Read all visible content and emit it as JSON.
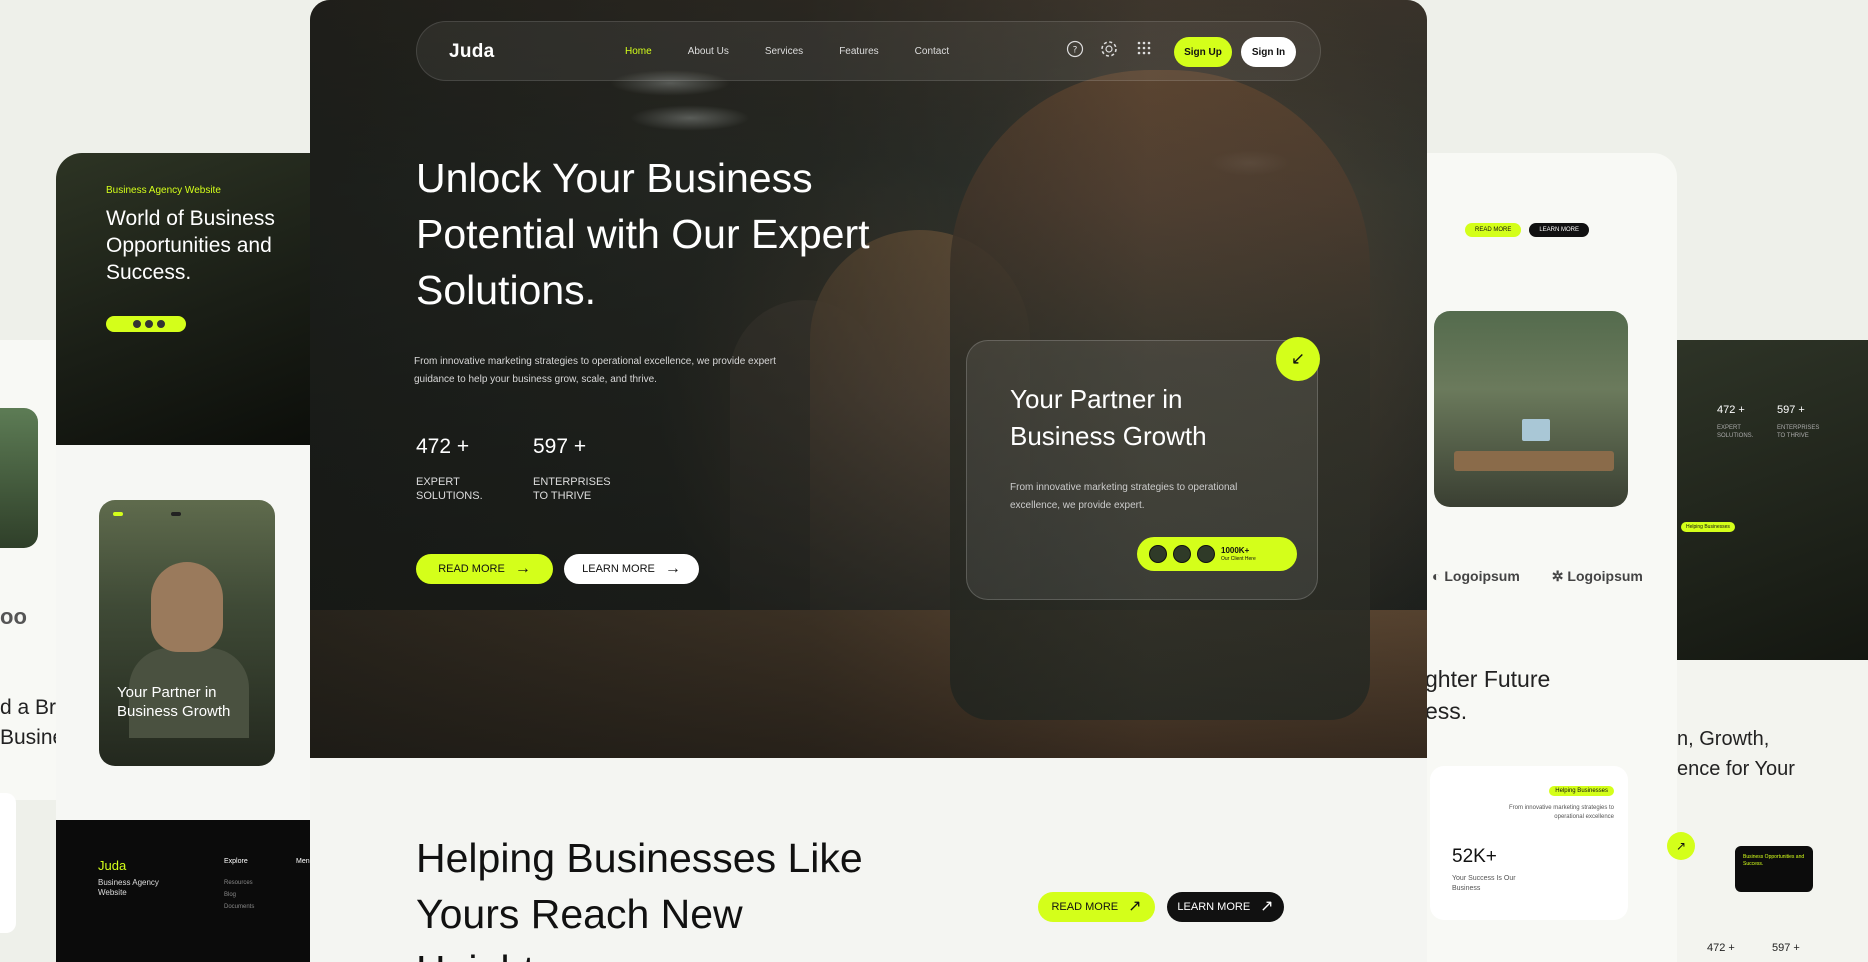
{
  "nav": {
    "logo": "Juda",
    "links": [
      "Home",
      "About Us",
      "Services",
      "Features",
      "Contact"
    ],
    "active_index": 0,
    "icons": [
      "help-circle-icon",
      "gear-icon",
      "grid-icon"
    ],
    "signup": "Sign Up",
    "signin": "Sign In"
  },
  "hero": {
    "title": "Unlock Your Business Potential with Our Expert Solutions.",
    "description": "From innovative marketing strategies to operational excellence, we provide expert guidance to help your business grow, scale, and thrive.",
    "stats": [
      {
        "value": "472 +",
        "label": "EXPERT SOLUTIONS."
      },
      {
        "value": "597 +",
        "label": "ENTERPRISES TO THRIVE"
      }
    ],
    "read_more": "READ MORE",
    "learn_more": "LEARN MORE"
  },
  "partner_card": {
    "title": "Your Partner in Business Growth",
    "description": "From innovative marketing strategies to operational excellence, we provide expert.",
    "clients_count": "1000K+",
    "clients_label": "Our Client Here"
  },
  "section2": {
    "title": "Helping Businesses Like Yours Reach New Heights",
    "read_more": "READ MORE",
    "learn_more": "LEARN MORE"
  },
  "left_preview": {
    "tag": "Business Agency Website",
    "title": "World of Business Opportunities and Success.",
    "photo_title": "Your Partner in Business Growth",
    "footer_brand": "Juda",
    "footer_desc": "Business Agency Website",
    "footer_col1": "Explore",
    "footer_col1_links": [
      "Resources",
      "Blog",
      "Documents"
    ],
    "footer_col2": "Menu"
  },
  "far_left": {
    "logo_fragment": "oo",
    "text_line1": "d a Bri",
    "text_line2": "Busine"
  },
  "right_preview": {
    "read_more": "READ MORE",
    "learn_more": "LEARN MORE",
    "logos": [
      "Logoipsum",
      "Logoipsum"
    ],
    "text_line1": "ghter Future",
    "text_line2": "ess.",
    "stat_tag": "Helping Businesses",
    "stat_desc": "From innovative marketing strategies to operational excellence",
    "stat_value": "52K+",
    "stat_label": "Your Success Is Our Business"
  },
  "far_right": {
    "stat1": "472 +",
    "stat1_label": "EXPERT SOLUTIONS.",
    "stat2": "597 +",
    "stat2_label": "ENTERPRISES TO THRIVE",
    "tag": "Helping Businesses",
    "text_line1": "n, Growth,",
    "text_line2": "ence for Your",
    "box_text": "Business Opportunities and Success.",
    "bottom_stat1": "472 +",
    "bottom_stat2": "597 +"
  },
  "colors": {
    "accent": "#d4ff1a",
    "dark": "#111111",
    "background": "#eef0ea"
  }
}
